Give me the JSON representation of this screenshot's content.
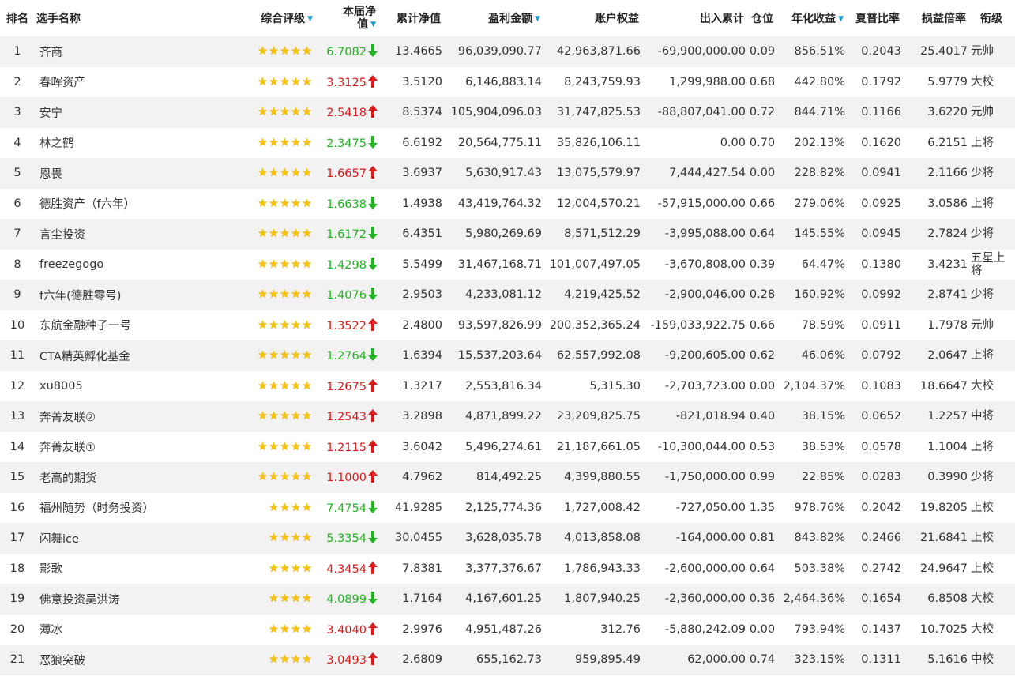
{
  "headers": {
    "rank": "排名",
    "name": "选手名称",
    "rating": "综合评级",
    "nav_line1": "本届净",
    "nav_line2": "值",
    "cum_nav": "累计净值",
    "profit": "盈利金额",
    "equity": "账户权益",
    "flow": "出入累计",
    "position": "仓位",
    "annual": "年化收益",
    "sharpe": "夏普比率",
    "pl_ratio": "损益倍率",
    "grade": "衔级"
  },
  "colors": {
    "up": "#dd1b1b",
    "down": "#22b522",
    "star": "#f5c211",
    "sort": "#1a9ad6",
    "stripe": "#f2f2f2"
  },
  "rows": [
    {
      "rank": "1",
      "name": "齐商",
      "stars": "★★★★★",
      "nav": "6.7082",
      "trend": "down",
      "cum_nav": "13.4665",
      "profit": "96,039,090.77",
      "equity": "42,963,871.66",
      "flow": "-69,900,000.00",
      "position": "0.09",
      "annual": "856.51%",
      "sharpe": "0.2043",
      "pl_ratio": "25.4017",
      "grade": "元帅"
    },
    {
      "rank": "2",
      "name": "春晖资产",
      "stars": "★★★★★",
      "nav": "3.3125",
      "trend": "up",
      "cum_nav": "3.5120",
      "profit": "6,146,883.14",
      "equity": "8,243,759.93",
      "flow": "1,299,988.00",
      "position": "0.68",
      "annual": "442.80%",
      "sharpe": "0.1792",
      "pl_ratio": "5.9779",
      "grade": "大校"
    },
    {
      "rank": "3",
      "name": "安宁",
      "stars": "★★★★★",
      "nav": "2.5418",
      "trend": "up",
      "cum_nav": "8.5374",
      "profit": "105,904,096.03",
      "equity": "31,747,825.53",
      "flow": "-88,807,041.00",
      "position": "0.72",
      "annual": "844.71%",
      "sharpe": "0.1166",
      "pl_ratio": "3.6220",
      "grade": "元帅"
    },
    {
      "rank": "4",
      "name": "林之鹤",
      "stars": "★★★★★",
      "nav": "2.3475",
      "trend": "down",
      "cum_nav": "6.6192",
      "profit": "20,564,775.11",
      "equity": "35,826,106.11",
      "flow": "0.00",
      "position": "0.70",
      "annual": "202.13%",
      "sharpe": "0.1620",
      "pl_ratio": "6.2151",
      "grade": "上将"
    },
    {
      "rank": "5",
      "name": "恩畏",
      "stars": "★★★★★",
      "nav": "1.6657",
      "trend": "up",
      "cum_nav": "3.6937",
      "profit": "5,630,917.43",
      "equity": "13,075,579.97",
      "flow": "7,444,427.54",
      "position": "0.00",
      "annual": "228.82%",
      "sharpe": "0.0941",
      "pl_ratio": "2.1166",
      "grade": "少将"
    },
    {
      "rank": "6",
      "name": "德胜资产（f六年）",
      "stars": "★★★★★",
      "nav": "1.6638",
      "trend": "down",
      "cum_nav": "1.4938",
      "profit": "43,419,764.32",
      "equity": "12,004,570.21",
      "flow": "-57,915,000.00",
      "position": "0.66",
      "annual": "279.06%",
      "sharpe": "0.0925",
      "pl_ratio": "3.0586",
      "grade": "上将"
    },
    {
      "rank": "7",
      "name": "言尘投资",
      "stars": "★★★★★",
      "nav": "1.6172",
      "trend": "down",
      "cum_nav": "6.4351",
      "profit": "5,980,269.69",
      "equity": "8,571,512.29",
      "flow": "-3,995,088.00",
      "position": "0.64",
      "annual": "145.55%",
      "sharpe": "0.0945",
      "pl_ratio": "2.7824",
      "grade": "少将"
    },
    {
      "rank": "8",
      "name": "freezegogo",
      "stars": "★★★★★",
      "nav": "1.4298",
      "trend": "down",
      "cum_nav": "5.5499",
      "profit": "31,467,168.71",
      "equity": "101,007,497.05",
      "flow": "-3,670,808.00",
      "position": "0.39",
      "annual": "64.47%",
      "sharpe": "0.1380",
      "pl_ratio": "3.4231",
      "grade": "五星上将"
    },
    {
      "rank": "9",
      "name": "f六年(德胜零号)",
      "stars": "★★★★★",
      "nav": "1.4076",
      "trend": "down",
      "cum_nav": "2.9503",
      "profit": "4,233,081.12",
      "equity": "4,219,425.52",
      "flow": "-2,900,046.00",
      "position": "0.28",
      "annual": "160.92%",
      "sharpe": "0.0992",
      "pl_ratio": "2.8741",
      "grade": "少将"
    },
    {
      "rank": "10",
      "name": "东航金融种子一号",
      "stars": "★★★★★",
      "nav": "1.3522",
      "trend": "up",
      "cum_nav": "2.4800",
      "profit": "93,597,826.99",
      "equity": "200,352,365.24",
      "flow": "-159,033,922.75",
      "position": "0.66",
      "annual": "78.59%",
      "sharpe": "0.0911",
      "pl_ratio": "1.7978",
      "grade": "元帅"
    },
    {
      "rank": "11",
      "name": "CTA精英孵化基金",
      "stars": "★★★★★",
      "nav": "1.2764",
      "trend": "down",
      "cum_nav": "1.6394",
      "profit": "15,537,203.64",
      "equity": "62,557,992.08",
      "flow": "-9,200,605.00",
      "position": "0.62",
      "annual": "46.06%",
      "sharpe": "0.0792",
      "pl_ratio": "2.0647",
      "grade": "上将"
    },
    {
      "rank": "12",
      "name": "xu8005",
      "stars": "★★★★★",
      "nav": "1.2675",
      "trend": "up",
      "cum_nav": "1.3217",
      "profit": "2,553,816.34",
      "equity": "5,315.30",
      "flow": "-2,703,723.00",
      "position": "0.00",
      "annual": "2,104.37%",
      "sharpe": "0.1083",
      "pl_ratio": "18.6647",
      "grade": "大校"
    },
    {
      "rank": "13",
      "name": "奔菁友联②",
      "stars": "★★★★★",
      "nav": "1.2543",
      "trend": "up",
      "cum_nav": "3.2898",
      "profit": "4,871,899.22",
      "equity": "23,209,825.75",
      "flow": "-821,018.94",
      "position": "0.40",
      "annual": "38.15%",
      "sharpe": "0.0652",
      "pl_ratio": "1.2257",
      "grade": "中将"
    },
    {
      "rank": "14",
      "name": "奔菁友联①",
      "stars": "★★★★★",
      "nav": "1.2115",
      "trend": "up",
      "cum_nav": "3.6042",
      "profit": "5,496,274.61",
      "equity": "21,187,661.05",
      "flow": "-10,300,044.00",
      "position": "0.53",
      "annual": "38.53%",
      "sharpe": "0.0578",
      "pl_ratio": "1.1004",
      "grade": "上将"
    },
    {
      "rank": "15",
      "name": "老高的期货",
      "stars": "★★★★★",
      "nav": "1.1000",
      "trend": "up",
      "cum_nav": "4.7962",
      "profit": "814,492.25",
      "equity": "4,399,880.55",
      "flow": "-1,750,000.00",
      "position": "0.99",
      "annual": "22.85%",
      "sharpe": "0.0283",
      "pl_ratio": "0.3990",
      "grade": "少将"
    },
    {
      "rank": "16",
      "name": "福州随势（时务投资）",
      "stars": "★★★★",
      "nav": "7.4754",
      "trend": "down",
      "cum_nav": "41.9285",
      "profit": "2,125,774.36",
      "equity": "1,727,008.42",
      "flow": "-727,050.00",
      "position": "1.35",
      "annual": "978.76%",
      "sharpe": "0.2042",
      "pl_ratio": "19.8205",
      "grade": "上校"
    },
    {
      "rank": "17",
      "name": "闪舞ice",
      "stars": "★★★★",
      "nav": "5.3354",
      "trend": "down",
      "cum_nav": "30.0455",
      "profit": "3,628,035.78",
      "equity": "4,013,858.08",
      "flow": "-164,000.00",
      "position": "0.81",
      "annual": "843.82%",
      "sharpe": "0.2466",
      "pl_ratio": "21.6841",
      "grade": "上校"
    },
    {
      "rank": "18",
      "name": "影歌",
      "stars": "★★★★",
      "nav": "4.3454",
      "trend": "up",
      "cum_nav": "7.8381",
      "profit": "3,377,376.67",
      "equity": "1,786,943.33",
      "flow": "-2,600,000.00",
      "position": "0.64",
      "annual": "503.38%",
      "sharpe": "0.2742",
      "pl_ratio": "24.9647",
      "grade": "上校"
    },
    {
      "rank": "19",
      "name": "佛意投资吴洪涛",
      "stars": "★★★★",
      "nav": "4.0899",
      "trend": "down",
      "cum_nav": "1.7164",
      "profit": "4,167,601.25",
      "equity": "1,807,940.25",
      "flow": "-2,360,000.00",
      "position": "0.36",
      "annual": "2,464.36%",
      "sharpe": "0.1654",
      "pl_ratio": "6.8508",
      "grade": "大校"
    },
    {
      "rank": "20",
      "name": "薄冰",
      "stars": "★★★★",
      "nav": "3.4040",
      "trend": "up",
      "cum_nav": "2.9976",
      "profit": "4,951,487.26",
      "equity": "312.76",
      "flow": "-5,880,242.09",
      "position": "0.00",
      "annual": "793.94%",
      "sharpe": "0.1437",
      "pl_ratio": "10.7025",
      "grade": "大校"
    },
    {
      "rank": "21",
      "name": "恶狼突破",
      "stars": "★★★★",
      "nav": "3.0493",
      "trend": "up",
      "cum_nav": "2.6809",
      "profit": "655,162.73",
      "equity": "959,895.49",
      "flow": "62,000.00",
      "position": "0.74",
      "annual": "323.15%",
      "sharpe": "0.1311",
      "pl_ratio": "5.1616",
      "grade": "中校"
    }
  ]
}
